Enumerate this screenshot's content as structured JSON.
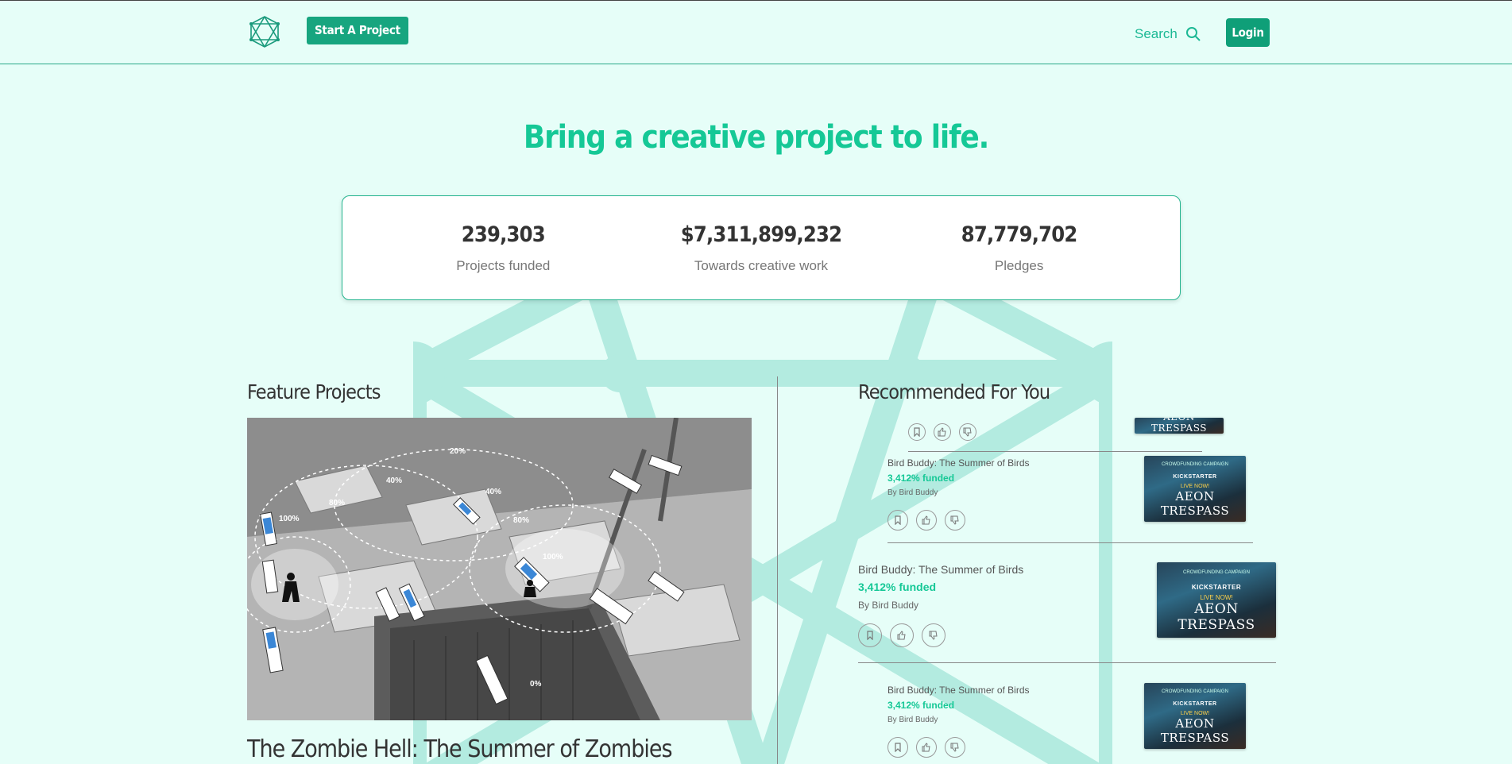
{
  "header": {
    "start_label": "Start A Project",
    "search_label": "Search",
    "login_label": "Login"
  },
  "hero": {
    "title": "Bring a creative project to life."
  },
  "stats": [
    {
      "value": "239,303",
      "label": "Projects funded"
    },
    {
      "value": "$7,311,899,232",
      "label": "Towards creative work"
    },
    {
      "value": "87,779,702",
      "label": "Pledges"
    }
  ],
  "featured": {
    "section_title": "Feature Projects",
    "project_name": "The Zombie Hell: The Summer of Zombies",
    "image_labels": [
      "20%",
      "40%",
      "40%",
      "80%",
      "80%",
      "100%",
      "100%",
      "0%"
    ]
  },
  "recommended": {
    "section_title": "Recommended For You",
    "items": [
      {
        "title": "Bird Buddy: The Summer of Birds",
        "funded": "3,412% funded",
        "by": "By Bird Buddy"
      },
      {
        "title": "Bird Buddy: The Summer of Birds",
        "funded": "3,412% funded",
        "by": "By Bird Buddy"
      },
      {
        "title": "Bird Buddy: The Summer of Birds",
        "funded": "3,412% funded",
        "by": "By Bird Buddy"
      }
    ],
    "thumb_text": {
      "campaign": "CROWDFUNDING CAMPAIGN",
      "kickstarter": "KICKSTARTER",
      "live": "LIVE NOW!",
      "brand": "AEON TRESPASS"
    }
  },
  "colors": {
    "background": "#e6fef8",
    "accent": "#15c896",
    "button": "#17a57f"
  },
  "icons": [
    "logo-icon",
    "search-icon",
    "bookmark-icon",
    "thumbs-up-icon",
    "thumbs-down-icon"
  ]
}
